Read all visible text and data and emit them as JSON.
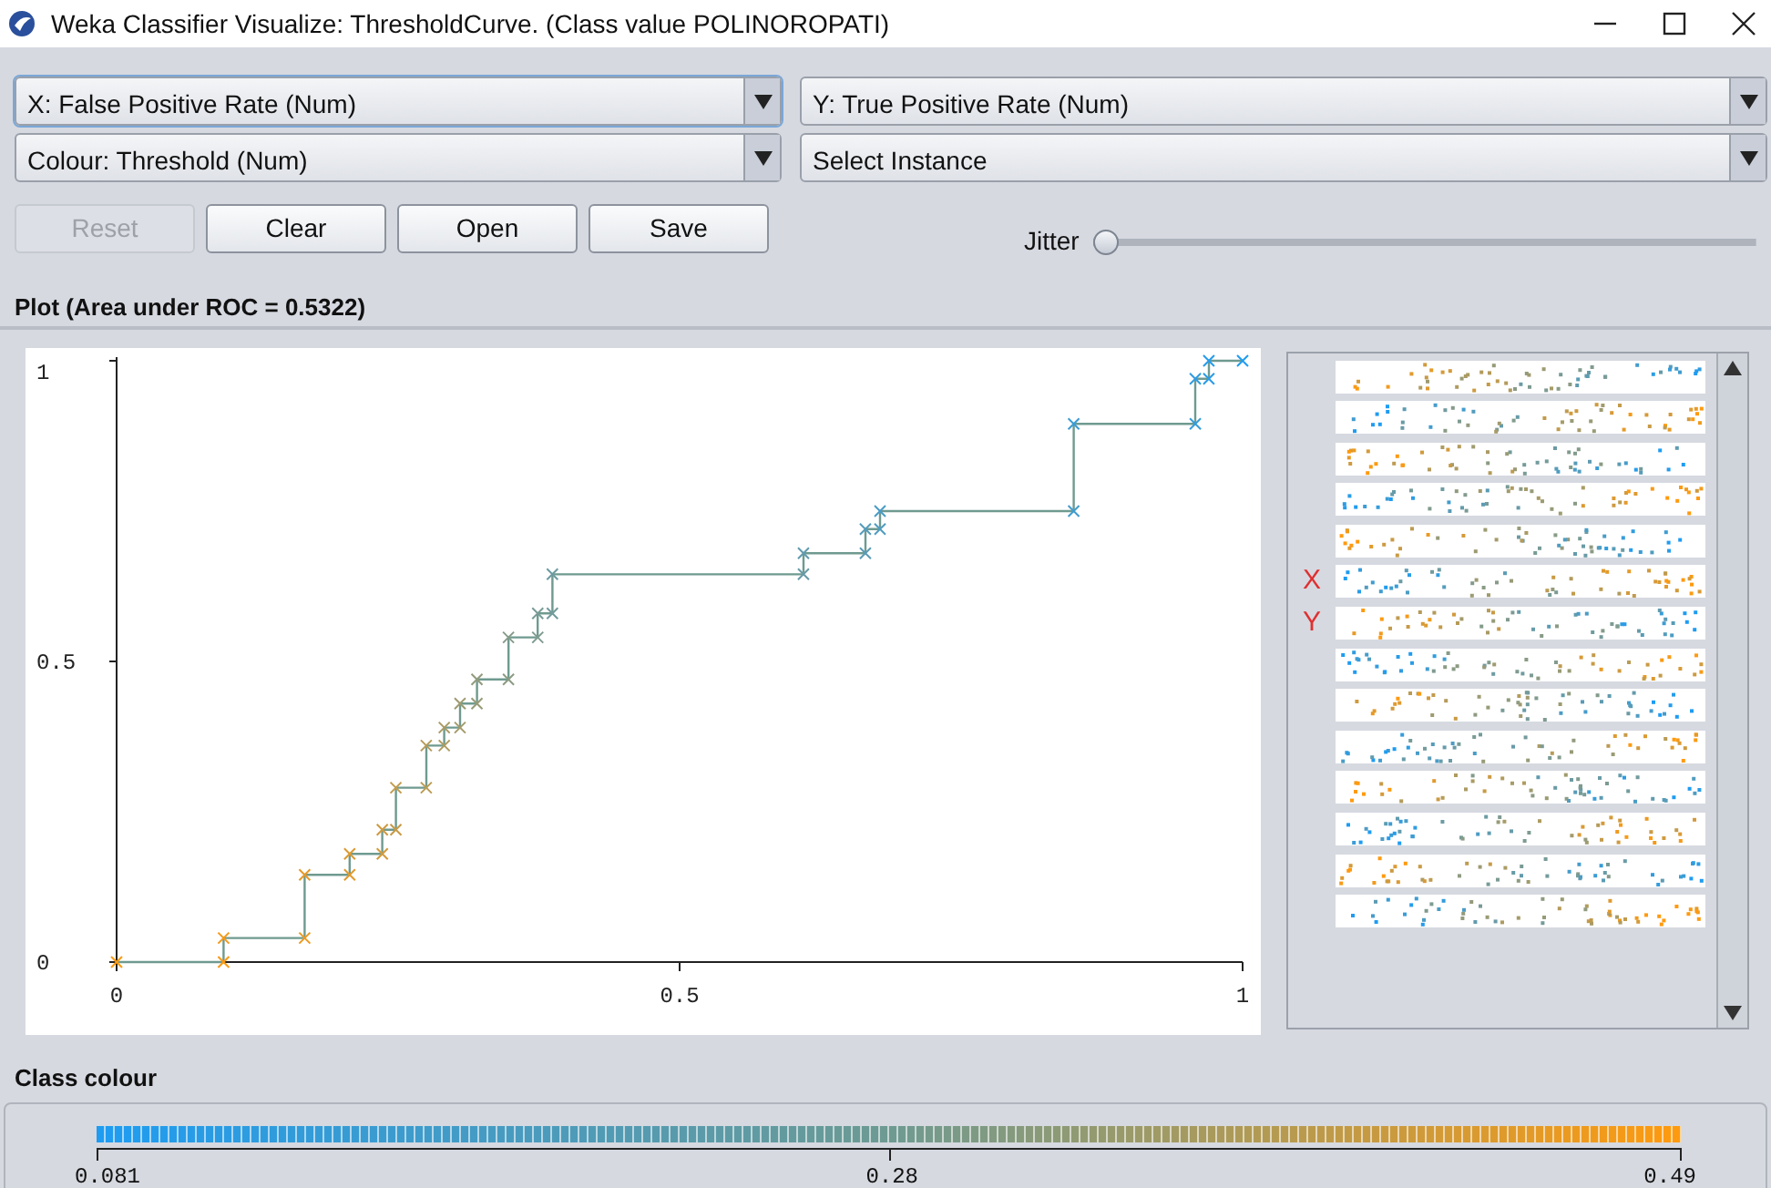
{
  "window": {
    "title": "Weka Classifier Visualize: ThresholdCurve. (Class value POLINOROPATI)"
  },
  "selectors": [
    {
      "label": "X: False Positive Rate (Num)",
      "focused": true
    },
    {
      "label": "Y: True Positive Rate (Num)",
      "focused": false
    },
    {
      "label": "Colour: Threshold (Num)",
      "focused": false
    },
    {
      "label": "Select Instance",
      "focused": false
    }
  ],
  "buttons": [
    {
      "label": "Reset",
      "disabled": true
    },
    {
      "label": "Clear",
      "disabled": false
    },
    {
      "label": "Open",
      "disabled": false
    },
    {
      "label": "Save",
      "disabled": false
    }
  ],
  "jitter": {
    "label": "Jitter",
    "level": 0
  },
  "plot": {
    "title": "Plot (Area under ROC = 0.5322)",
    "chart_data": {
      "type": "line",
      "x": [
        0,
        0.095,
        0.095,
        0.167,
        0.167,
        0.207,
        0.207,
        0.236,
        0.236,
        0.248,
        0.248,
        0.275,
        0.275,
        0.291,
        0.291,
        0.305,
        0.305,
        0.32,
        0.32,
        0.348,
        0.348,
        0.374,
        0.374,
        0.387,
        0.387,
        0.61,
        0.61,
        0.665,
        0.665,
        0.678,
        0.678,
        0.85,
        0.85,
        0.958,
        0.958,
        0.97,
        0.97,
        1
      ],
      "series": [
        {
          "color": "#6f9a8f",
          "marker": "x",
          "values": [
            0,
            0,
            0.04,
            0.04,
            0.145,
            0.145,
            0.18,
            0.18,
            0.22,
            0.22,
            0.29,
            0.29,
            0.36,
            0.36,
            0.39,
            0.39,
            0.43,
            0.43,
            0.47,
            0.47,
            0.54,
            0.54,
            0.58,
            0.58,
            0.645,
            0.645,
            0.68,
            0.68,
            0.72,
            0.72,
            0.75,
            0.75,
            0.895,
            0.895,
            0.97,
            0.97,
            1,
            1
          ]
        }
      ],
      "xlim": [
        0,
        1
      ],
      "ylim": [
        0,
        1
      ],
      "xticks": [
        0,
        0.5,
        1
      ],
      "yticks": [
        0,
        0.5,
        1
      ]
    }
  },
  "attribute_rows": [
    {},
    {},
    {},
    {},
    {},
    {
      "label": "X"
    },
    {
      "label": "Y"
    },
    {},
    {},
    {},
    {},
    {},
    {},
    {}
  ],
  "class_colour": {
    "title": "Class colour",
    "ticks": [
      "0.081",
      "0.28",
      "0.49"
    ]
  }
}
